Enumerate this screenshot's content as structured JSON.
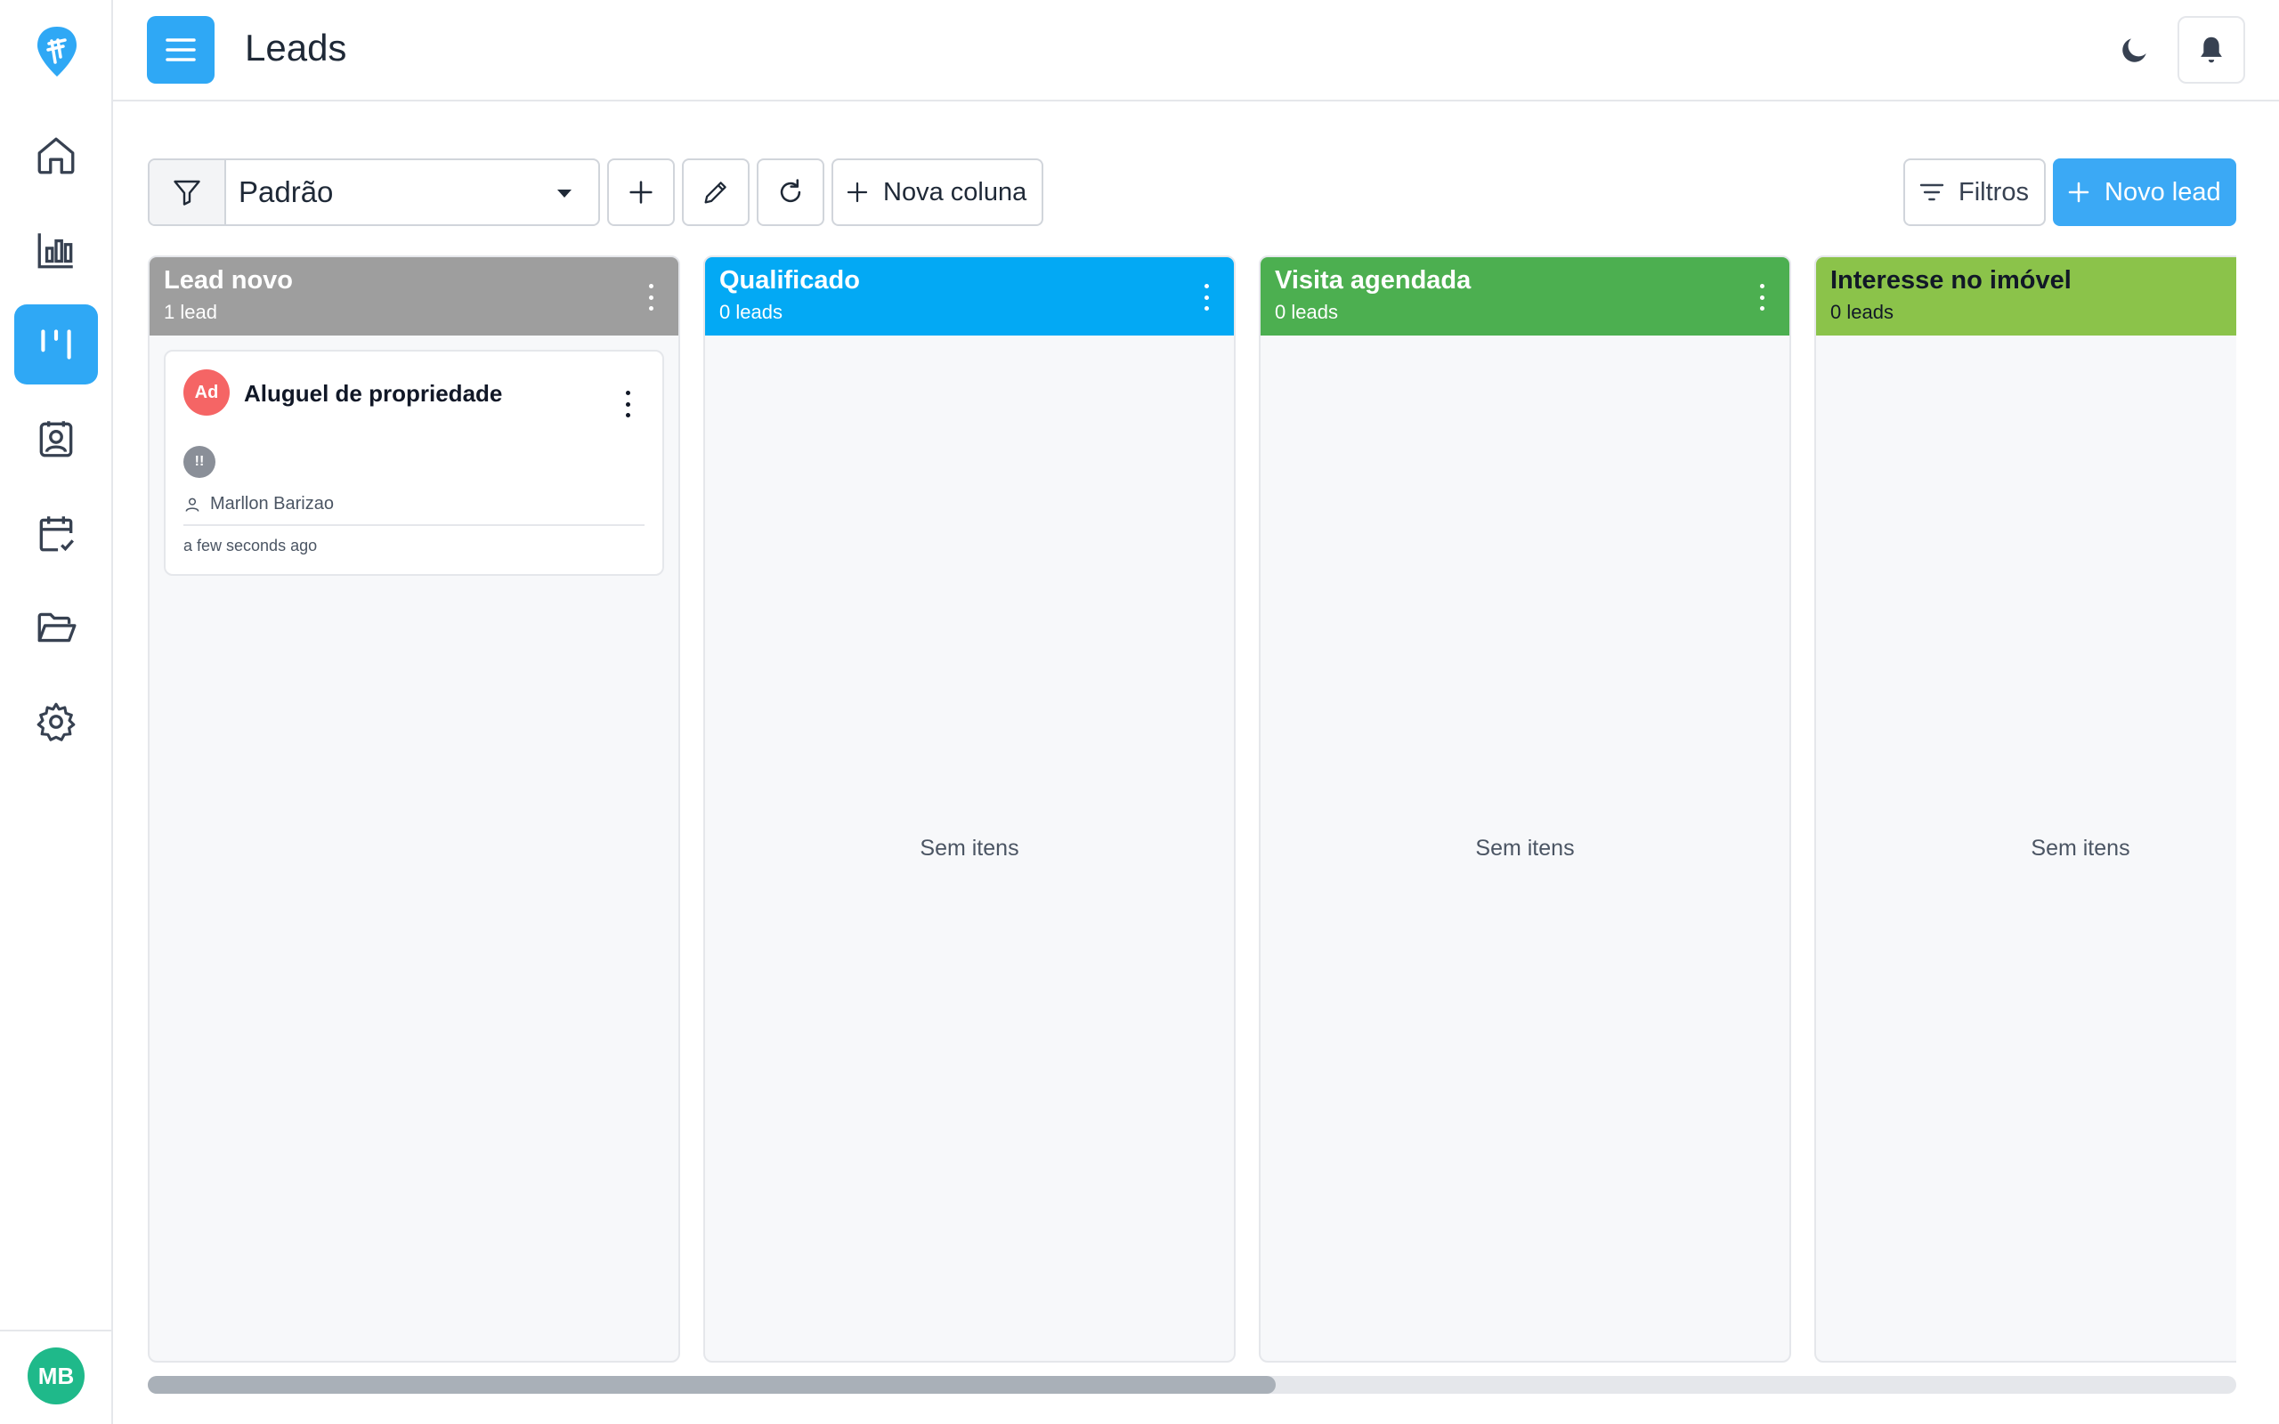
{
  "app": {
    "page_title": "Leads",
    "user_initials": "MB",
    "accent": "#2fa8f5"
  },
  "sidebar": {
    "items": [
      {
        "name": "home-icon",
        "active": false
      },
      {
        "name": "bar-chart-icon",
        "active": false
      },
      {
        "name": "kanban-icon",
        "active": true
      },
      {
        "name": "contacts-icon",
        "active": false
      },
      {
        "name": "calendar-check-icon",
        "active": false
      },
      {
        "name": "folder-open-icon",
        "active": false
      },
      {
        "name": "gear-icon",
        "active": false
      }
    ]
  },
  "toolbar": {
    "pipeline_selected": "Padrão",
    "new_column_label": "Nova coluna",
    "filters_label": "Filtros",
    "new_lead_label": "Novo lead"
  },
  "columns": [
    {
      "title": "Lead novo",
      "count": "1 lead",
      "color": "#9e9e9e",
      "empty_text": ""
    },
    {
      "title": "Qualificado",
      "count": "0 leads",
      "color": "#03a9f4",
      "empty_text": "Sem itens"
    },
    {
      "title": "Visita agendada",
      "count": "0 leads",
      "color": "#4caf50",
      "empty_text": "Sem itens"
    },
    {
      "title": "Interesse no imóvel",
      "count": "0 leads",
      "color": "#8bc34a",
      "empty_text": "Sem itens"
    }
  ],
  "card": {
    "source_badge": "Ad",
    "title": "Aluguel de propriedade",
    "priority": "!!",
    "owner": "Marllon Barizao",
    "time": "a few seconds ago"
  },
  "scrollbar": {
    "visible_fraction": 0.54
  }
}
